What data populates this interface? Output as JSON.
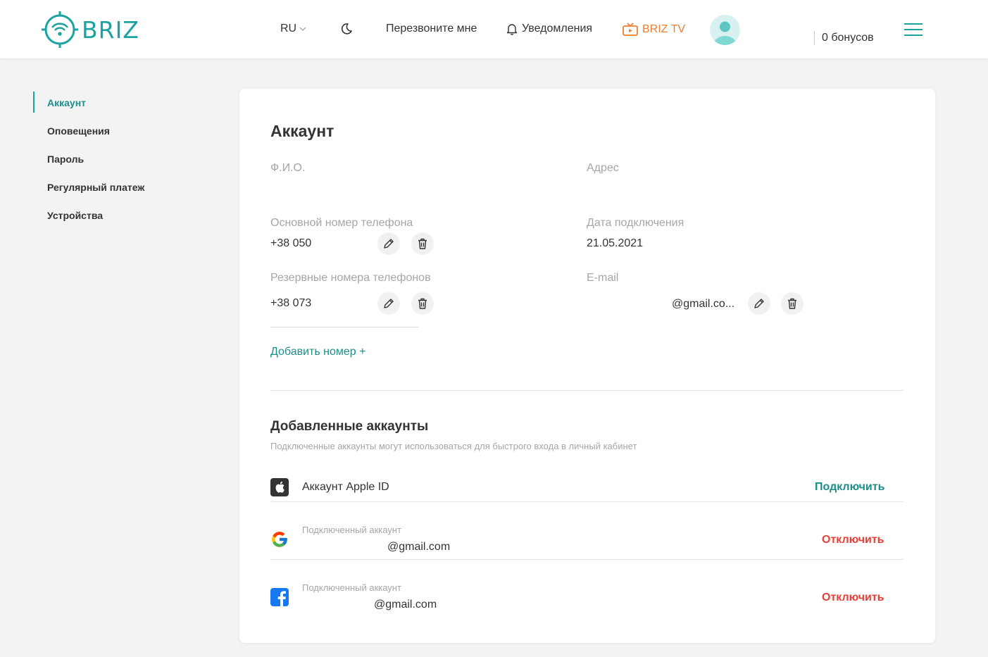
{
  "header": {
    "logo_text": "BRIZ",
    "lang": "RU",
    "callback": "Перезвоните мне",
    "notifications": "Уведомления",
    "tv": "BRIZ TV",
    "bonus": "0 бонусов",
    "accent_color": "#1aa3a0",
    "tv_color": "#f07e2e"
  },
  "sidebar": {
    "items": [
      {
        "label": "Аккаунт",
        "active": true
      },
      {
        "label": "Оповещения"
      },
      {
        "label": "Пароль"
      },
      {
        "label": "Регулярный платеж"
      },
      {
        "label": "Устройства"
      }
    ]
  },
  "account": {
    "title": "Аккаунт",
    "fio_label": "Ф.И.О.",
    "address_label": "Адрес",
    "main_phone_label": "Основной номер телефона",
    "main_phone": "+38 050",
    "connect_date_label": "Дата подключения",
    "connect_date": "21.05.2021",
    "reserve_phones_label": "Резервные номера телефонов",
    "reserve_phone": "+38 073",
    "email_label": "E-mail",
    "email": "@gmail.co...",
    "add_number": "Добавить номер +"
  },
  "linked": {
    "title": "Добавленные аккаунты",
    "description": "Подключенные аккаунты могут использоваться для быстрого входа в личный кабинет",
    "apple": {
      "label": "Аккаунт Apple ID",
      "action": "Подключить",
      "icon": "apple-icon"
    },
    "google": {
      "caption": "Подключенный аккаунт",
      "email": "@gmail.com",
      "action": "Отключить",
      "icon": "google-icon"
    },
    "facebook": {
      "caption": "Подключенный аккаунт",
      "email": "@gmail.com",
      "action": "Отключить",
      "icon": "facebook-icon"
    }
  }
}
